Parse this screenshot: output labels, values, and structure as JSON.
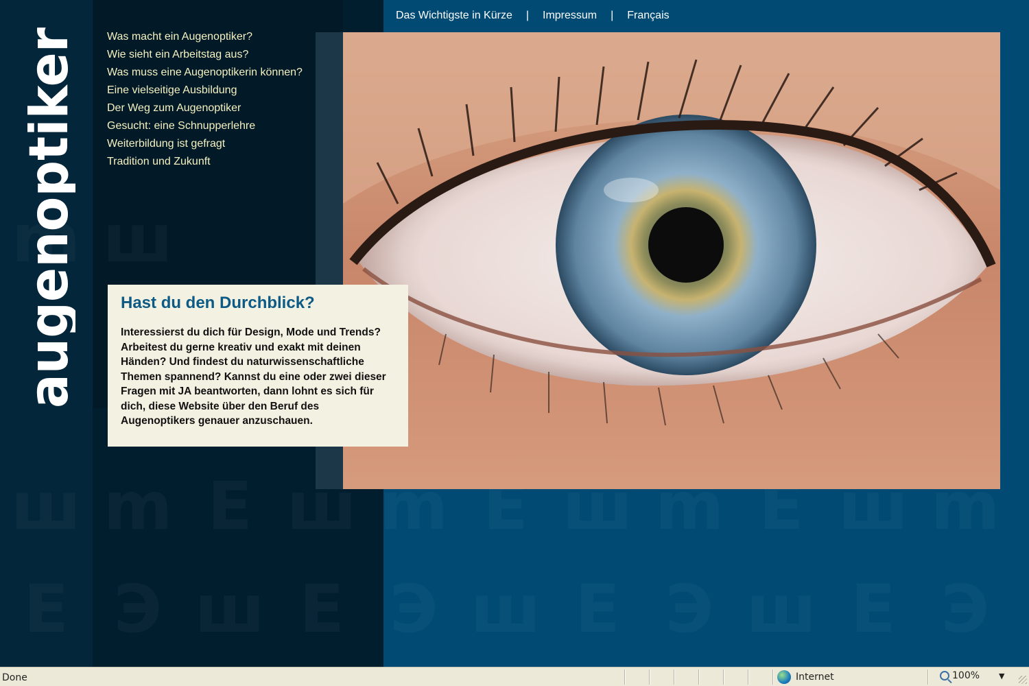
{
  "logo": {
    "text": "augenoptiker"
  },
  "top_nav": {
    "items": [
      "Das Wichtigste in Kürze",
      "Impressum",
      "Français"
    ],
    "separator": "|"
  },
  "sidebar": {
    "items": [
      "Was macht ein Augenoptiker?",
      "Wie sieht ein Arbeitstag aus?",
      "Was muss eine Augenoptikerin können?",
      "Eine vielseitige Ausbildung",
      "Der Weg zum Augenoptiker",
      "Gesucht: eine Schnupperlehre",
      "Weiterbildung ist gefragt",
      "Tradition und Zukunft"
    ]
  },
  "teaser": {
    "title": "Hast du den Durchblick?",
    "body": "Interessierst du dich für Design, Mode und Trends? Arbeitest du gerne kreativ und exakt mit deinen Händen? Und findest du naturwissenschaftliche Themen spannend? Kannst du eine oder zwei dieser Fragen mit JA beantworten, dann lohnt es sich für dich, diese Website über den Beruf des Augenoptikers genauer anzuschauen."
  },
  "statusbar": {
    "status": "Done",
    "zone": "Internet",
    "zoom": "100%"
  },
  "colors": {
    "background": "#004a74",
    "left_panel": "#011e2f",
    "nav_text": "#f5f1c0",
    "teaser_bg": "#f3f1e2",
    "teaser_title": "#0d5a85"
  }
}
